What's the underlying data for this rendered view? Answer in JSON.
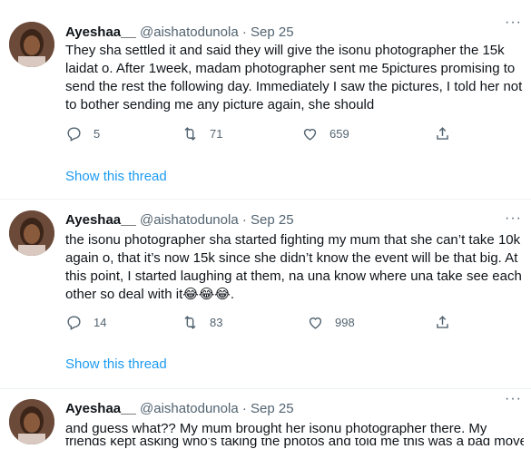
{
  "tweets": [
    {
      "name": "Ayeshaa__",
      "handle": "@aishatodunola",
      "separator": "·",
      "date": "Sep 25",
      "text": "They sha settled it and said they will give the isonu photographer the 15k laidat o. After 1week, madam photographer sent me 5pictures promising to send the rest the following day. Immediately I saw the pictures, I told her not to bother sending me any picture again, she should",
      "replies": "5",
      "retweets": "71",
      "likes": "659",
      "show_thread": "Show this thread"
    },
    {
      "name": "Ayeshaa__",
      "handle": "@aishatodunola",
      "separator": "·",
      "date": "Sep 25",
      "text": "the isonu photographer sha started fighting my mum that she can’t take 10k again o, that it’s now 15k since she didn’t know the event will be that big. At this point, I started laughing at them, na una know where una take see each other so deal with it😂😂😂.",
      "replies": "14",
      "retweets": "83",
      "likes": "998",
      "show_thread": "Show this thread"
    },
    {
      "name": "Ayeshaa__",
      "handle": "@aishatodunola",
      "separator": "·",
      "date": "Sep 25",
      "text": "and guess what?? My mum brought her isonu photographer there. My",
      "text_cut": "friends kept asking who's taking the photos and told me this was a bad move"
    }
  ],
  "more_glyph": "···",
  "colors": {
    "accent": "#1d9bf0",
    "muted": "#536471",
    "text": "#0f1419",
    "divider": "#eff3f4"
  },
  "icons": [
    "reply-icon",
    "retweet-icon",
    "like-icon",
    "share-icon",
    "more-icon"
  ]
}
